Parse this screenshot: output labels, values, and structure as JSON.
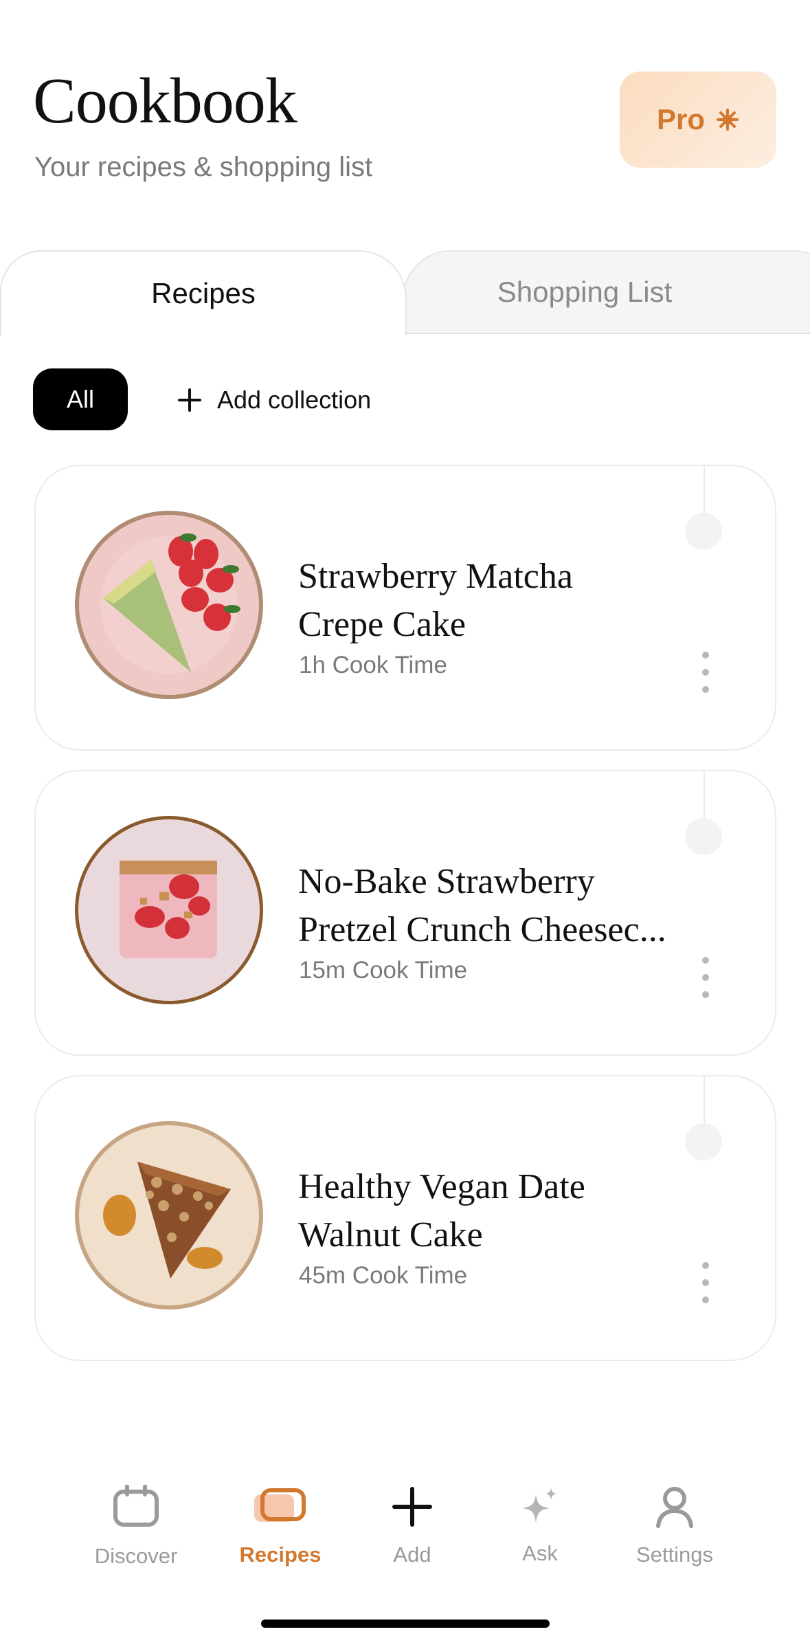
{
  "header": {
    "title": "Cookbook",
    "subtitle": "Your recipes & shopping list",
    "pro_label": "Pro"
  },
  "tabs": [
    {
      "label": "Recipes",
      "active": true
    },
    {
      "label": "Shopping List",
      "active": false
    }
  ],
  "filters": {
    "all_label": "All",
    "add_collection_label": "Add collection"
  },
  "recipes": [
    {
      "title_line1": "Strawberry Matcha",
      "title_line2": "Crepe Cake",
      "time": "1h Cook Time"
    },
    {
      "title_line1": "No-Bake Strawberry",
      "title_line2": "Pretzel Crunch Cheesec...",
      "time": "15m Cook Time"
    },
    {
      "title_line1": "Healthy Vegan Date",
      "title_line2": "Walnut Cake",
      "time": "45m Cook Time"
    }
  ],
  "bottom_nav": [
    {
      "label": "Discover",
      "icon": "calendar-icon",
      "active": false
    },
    {
      "label": "Recipes",
      "icon": "recipes-icon",
      "active": true
    },
    {
      "label": "Add",
      "icon": "plus-icon",
      "active": false
    },
    {
      "label": "Ask",
      "icon": "sparkle-icon",
      "active": false
    },
    {
      "label": "Settings",
      "icon": "person-icon",
      "active": false
    }
  ],
  "colors": {
    "accent": "#d2782f",
    "pro_bg": "#fbdcc0",
    "chip_bg": "#000000"
  }
}
